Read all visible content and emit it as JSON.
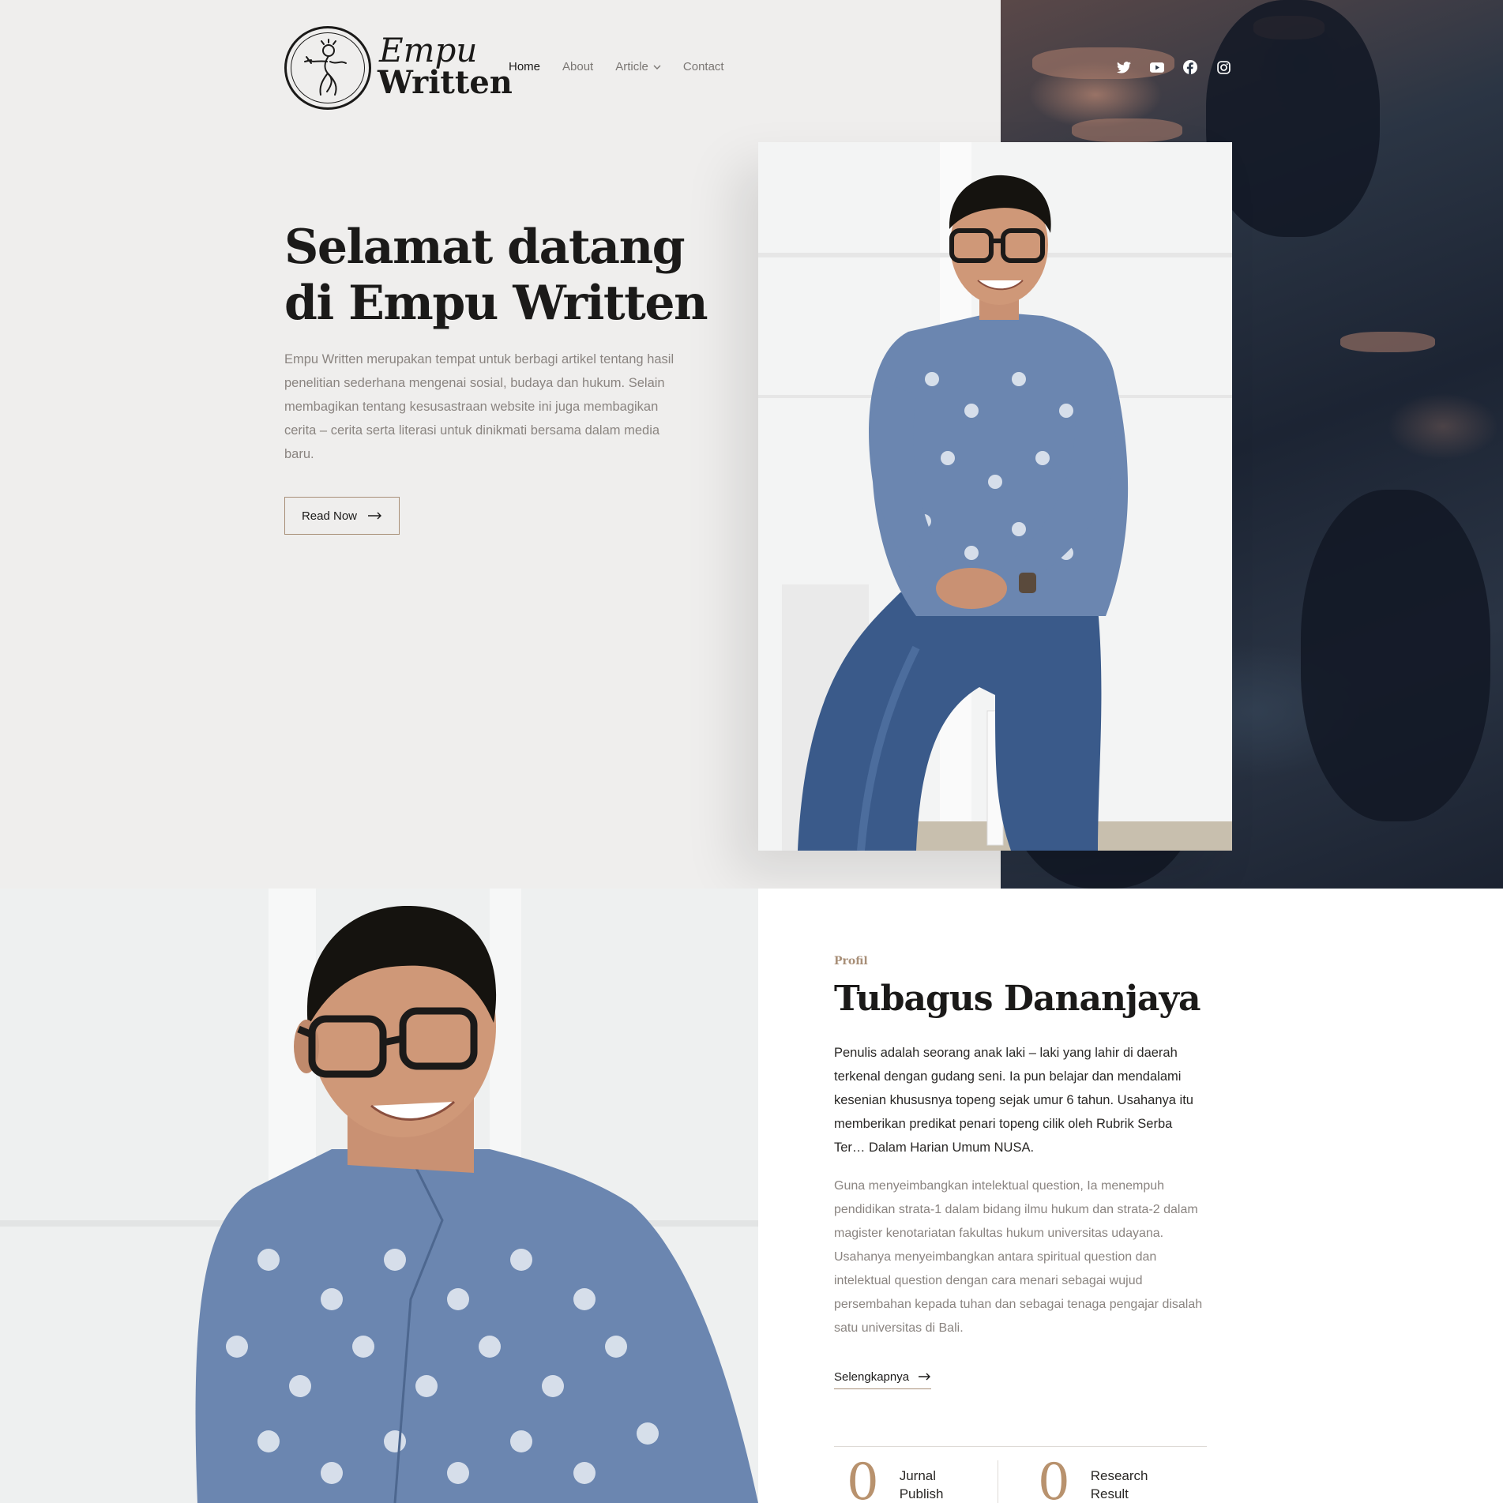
{
  "brand": {
    "name_line1": "Empu",
    "name_line2": "Written"
  },
  "nav": {
    "items": [
      {
        "label": "Home",
        "active": true
      },
      {
        "label": "About",
        "active": false
      },
      {
        "label": "Article",
        "active": false,
        "has_dropdown": true
      },
      {
        "label": "Contact",
        "active": false
      }
    ]
  },
  "social": [
    "twitter-icon",
    "youtube-icon",
    "facebook-icon",
    "instagram-icon"
  ],
  "hero": {
    "title": "Selamat datang di Empu Written",
    "text": "Empu Written merupakan tempat untuk berbagi artikel tentang hasil penelitian sederhana mengenai sosial, budaya dan hukum. Selain membagikan tentang kesusastraan website ini juga membagikan cerita – cerita serta literasi untuk dinikmati bersama dalam media baru.",
    "button_label": "Read Now"
  },
  "profile": {
    "label": "Profil",
    "name": "Tubagus Dananjaya",
    "lead": "Penulis adalah seorang anak laki – laki yang lahir di daerah terkenal dengan gudang seni. Ia pun belajar dan mendalami kesenian khususnya topeng sejak umur 6 tahun. Usahanya itu memberikan predikat penari topeng cilik oleh Rubrik Serba Ter… Dalam Harian Umum NUSA.",
    "body": "Guna menyeimbangkan intelektual question, Ia menempuh pendidikan strata-1 dalam bidang ilmu hukum dan strata-2 dalam magister kenotariatan fakultas hukum universitas udayana. Usahanya menyeimbangkan antara spiritual question dan intelektual question dengan cara menari sebagai wujud persembahan kepada tuhan dan sebagai tenaga pengajar disalah satu universitas di Bali.",
    "more_label": "Selengkapnya",
    "stats": [
      {
        "value": "0",
        "label_line1": "Jurnal",
        "label_line2": "Publish"
      },
      {
        "value": "0",
        "label_line1": "Research",
        "label_line2": "Result"
      }
    ]
  },
  "colors": {
    "accent": "#a88f78",
    "stat_number": "#b8926e",
    "text_dark": "#1b1a19",
    "text_muted": "#8a8480",
    "hero_bg": "#efeeed",
    "shirt": "#6b86b0",
    "jeans": "#3a5a8a"
  }
}
